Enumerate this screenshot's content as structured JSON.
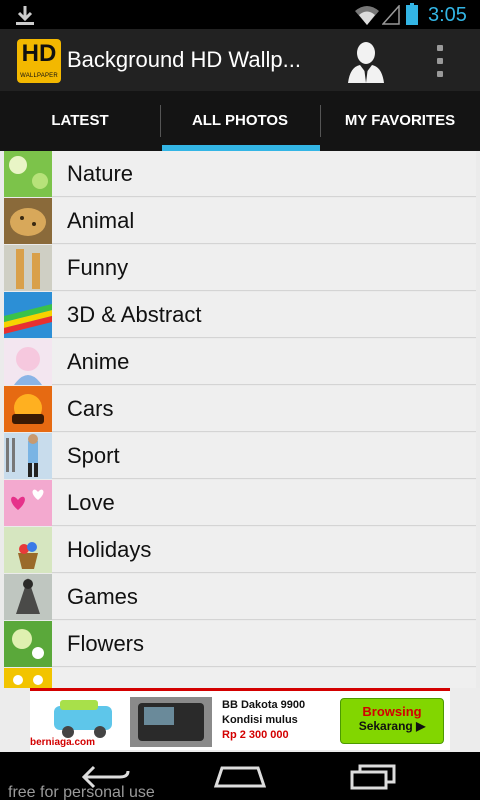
{
  "status_bar": {
    "time": "3:05"
  },
  "action_bar": {
    "logo_text": "HD",
    "logo_subtext": "WALLPAPER",
    "title": "Background HD Wallp..."
  },
  "tabs": [
    {
      "label": "LATEST",
      "selected": false
    },
    {
      "label": "ALL PHOTOS",
      "selected": true
    },
    {
      "label": "MY FAVORITES",
      "selected": false
    }
  ],
  "categories": [
    {
      "label": "Nature"
    },
    {
      "label": "Animal"
    },
    {
      "label": "Funny"
    },
    {
      "label": "3D & Abstract"
    },
    {
      "label": "Anime"
    },
    {
      "label": "Cars"
    },
    {
      "label": "Sport"
    },
    {
      "label": "Love"
    },
    {
      "label": "Holidays"
    },
    {
      "label": "Games"
    },
    {
      "label": "Flowers"
    }
  ],
  "ad": {
    "brand": "berniaga.com",
    "line1": "BB Dakota 9900",
    "line2": "Kondisi mulus",
    "line3": "Rp 2 300 000",
    "cta_line1": "Browsing",
    "cta_line2": "Sekarang ▶"
  },
  "watermark": "free for personal use",
  "colors": {
    "accent": "#33b5e5",
    "logo": "#f3b800",
    "ad_red": "#d30000",
    "ad_green": "#82d600"
  }
}
